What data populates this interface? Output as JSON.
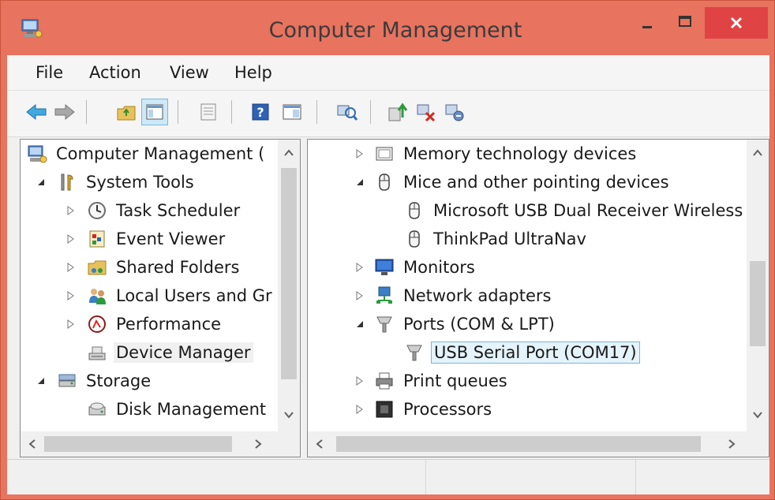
{
  "window": {
    "title": "Computer Management"
  },
  "menu": [
    "File",
    "Action",
    "View",
    "Help"
  ],
  "toolbar": {
    "icons": [
      "back-icon",
      "forward-icon",
      "up-folder-icon",
      "show-hide-tree-icon",
      "properties-icon",
      "help-icon",
      "show-action-pane-icon",
      "scan-hardware-icon",
      "update-driver-icon",
      "uninstall-device-icon",
      "disable-device-icon"
    ]
  },
  "left_tree": [
    {
      "label": "Computer Management (",
      "level": 0,
      "expander": "none"
    },
    {
      "label": "System Tools",
      "level": 1,
      "expander": "expanded"
    },
    {
      "label": "Task Scheduler",
      "level": 2,
      "expander": "collapsed"
    },
    {
      "label": "Event Viewer",
      "level": 2,
      "expander": "collapsed"
    },
    {
      "label": "Shared Folders",
      "level": 2,
      "expander": "collapsed"
    },
    {
      "label": "Local Users and Gr",
      "level": 2,
      "expander": "collapsed"
    },
    {
      "label": "Performance",
      "level": 2,
      "expander": "collapsed"
    },
    {
      "label": "Device Manager",
      "level": 2,
      "expander": "none",
      "selected": true
    },
    {
      "label": "Storage",
      "level": 1,
      "expander": "expanded"
    },
    {
      "label": "Disk Management",
      "level": 2,
      "expander": "none"
    }
  ],
  "right_tree": [
    {
      "label": "Memory technology devices",
      "level": 1,
      "expander": "collapsed"
    },
    {
      "label": "Mice and other pointing devices",
      "level": 1,
      "expander": "expanded"
    },
    {
      "label": "Microsoft USB Dual Receiver Wireless",
      "level": 2,
      "expander": "none"
    },
    {
      "label": "ThinkPad UltraNav",
      "level": 2,
      "expander": "none"
    },
    {
      "label": "Monitors",
      "level": 1,
      "expander": "collapsed"
    },
    {
      "label": "Network adapters",
      "level": 1,
      "expander": "collapsed"
    },
    {
      "label": "Ports (COM & LPT)",
      "level": 1,
      "expander": "expanded"
    },
    {
      "label": "USB Serial Port (COM17)",
      "level": 2,
      "expander": "none",
      "selected": true
    },
    {
      "label": "Print queues",
      "level": 1,
      "expander": "collapsed"
    },
    {
      "label": "Processors",
      "level": 1,
      "expander": "collapsed"
    }
  ],
  "colors": {
    "titlebar": "#e8735f",
    "close_button": "#e04343",
    "selection_border": "#78b6e0",
    "selection_fill": "#e5f3fb"
  }
}
